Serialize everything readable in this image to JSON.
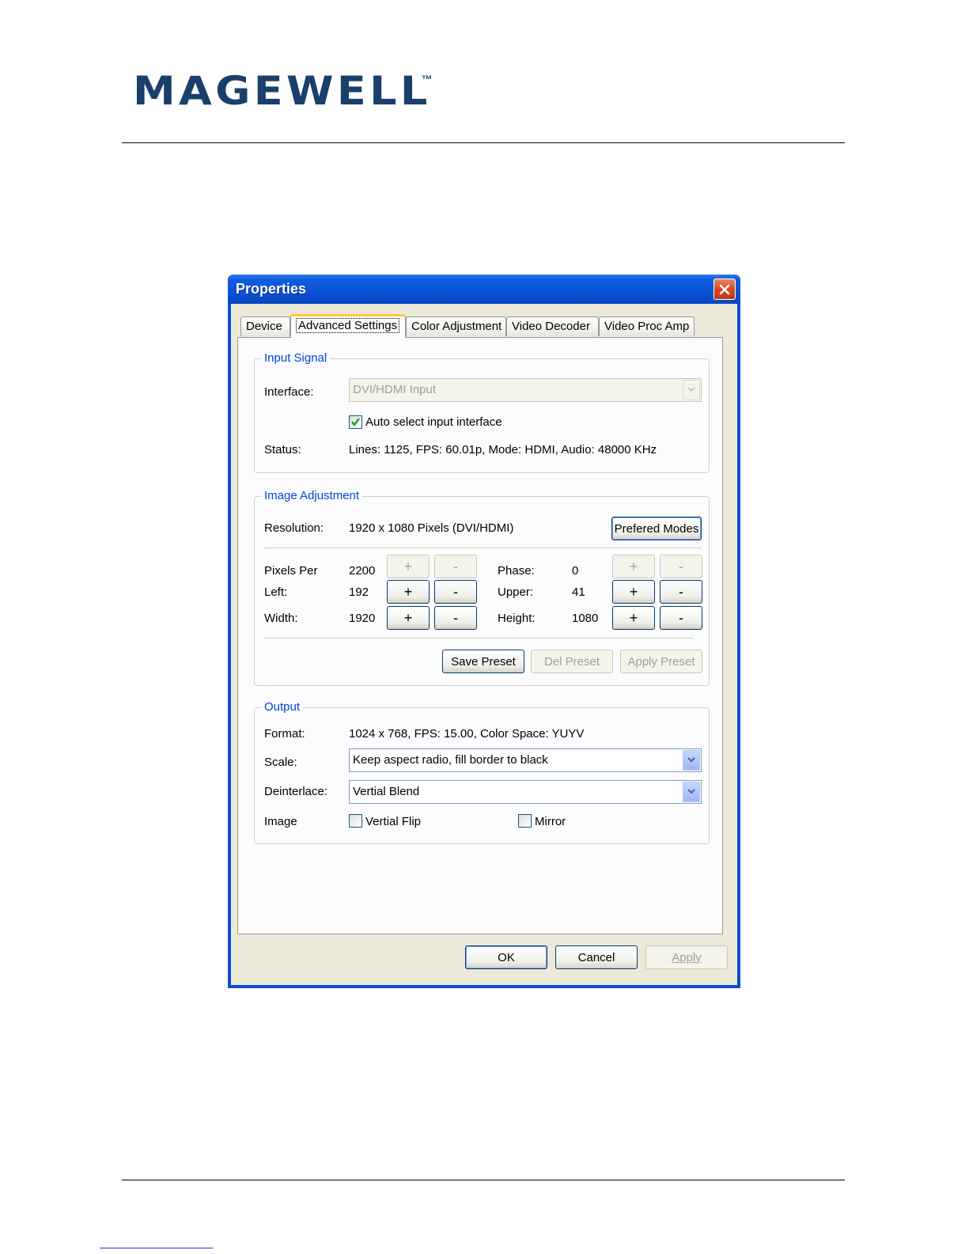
{
  "document": {
    "logo": "MAGEWELL",
    "logo_mark": "™"
  },
  "window": {
    "title": "Properties",
    "tabs": [
      {
        "label": "Device"
      },
      {
        "label": "Advanced Settings"
      },
      {
        "label": "Color Adjustment"
      },
      {
        "label": "Video Decoder"
      },
      {
        "label": "Video Proc Amp"
      }
    ],
    "input_signal": {
      "title": "Input Signal",
      "interface_label": "Interface:",
      "interface_value": "DVI/HDMI Input",
      "auto_select_label": "Auto select input interface",
      "auto_select_checked": true,
      "status_label": "Status:",
      "status_value": "Lines: 1125, FPS: 60.01p, Mode: HDMI, Audio: 48000 KHz"
    },
    "image_adjustment": {
      "title": "Image Adjustment",
      "resolution_label": "Resolution:",
      "resolution_value": "1920 x 1080 Pixels (DVI/HDMI)",
      "prefered_modes": "Prefered Modes",
      "pixels_per_label": "Pixels Per",
      "pixels_per_value": "2200",
      "left_label": "Left:",
      "left_value": "192",
      "width_label": "Width:",
      "width_value": "1920",
      "phase_label": "Phase:",
      "phase_value": "0",
      "upper_label": "Upper:",
      "upper_value": "41",
      "height_label": "Height:",
      "height_value": "1080",
      "plus": "+",
      "minus": "-",
      "save_preset": "Save Preset",
      "del_preset": "Del Preset",
      "apply_preset": "Apply Preset"
    },
    "output": {
      "title": "Output",
      "format_label": "Format:",
      "format_value": "1024 x 768, FPS: 15.00, Color Space: YUYV",
      "scale_label": "Scale:",
      "scale_value": "Keep aspect radio, fill border to black",
      "deinterlace_label": "Deinterlace:",
      "deinterlace_value": "Vertial Blend",
      "image_label": "Image",
      "vertial_flip_label": "Vertial Flip",
      "vertial_flip_checked": false,
      "mirror_label": "Mirror",
      "mirror_checked": false
    },
    "buttons": {
      "ok": "OK",
      "cancel": "Cancel",
      "apply": "Apply"
    }
  },
  "colors": {
    "brand": "#1a3f6b",
    "titlebar": "#0a52d6",
    "group_title": "#0046d5"
  }
}
